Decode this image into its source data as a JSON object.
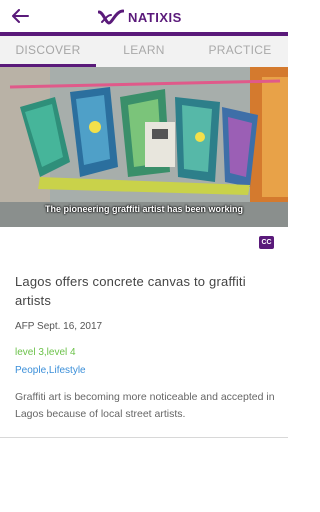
{
  "app": {
    "logo_text": "NATIXIS",
    "brand_color": "#5a1a7a"
  },
  "tabs": [
    {
      "label": "DISCOVER",
      "active": true
    },
    {
      "label": "LEARN",
      "active": false
    },
    {
      "label": "PRACTICE",
      "active": false
    }
  ],
  "video": {
    "caption": "The pioneering graffiti artist has been working"
  },
  "article": {
    "cc_label": "CC",
    "title": "Lagos offers concrete canvas to graffiti artists",
    "meta": "AFP Sept. 16, 2017",
    "levels": "level 3,level 4",
    "categories": "People,Lifestyle",
    "description": "Graffiti art is becoming more noticeable and accepted in Lagos because of local street artists."
  },
  "colors": {
    "levels": "#6cc24a",
    "categories": "#3b8fd9"
  }
}
